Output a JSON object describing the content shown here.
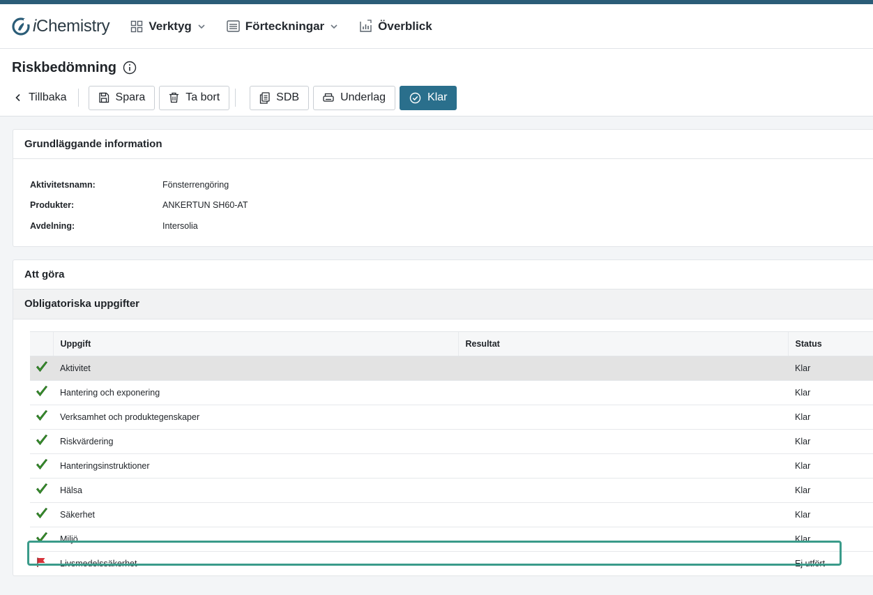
{
  "app": {
    "logo_prefix": "i",
    "logo_name": "Chemistry"
  },
  "nav": {
    "tools": "Verktyg",
    "lists": "Förteckningar",
    "overview": "Överblick"
  },
  "page": {
    "title": "Riskbedömning"
  },
  "toolbar": {
    "back": "Tillbaka",
    "save": "Spara",
    "delete": "Ta bort",
    "sds": "SDB",
    "basis": "Underlag",
    "done": "Klar"
  },
  "basic_info": {
    "header": "Grundläggande information",
    "rows": [
      {
        "label": "Aktivitetsnamn:",
        "value": "Fönsterrengöring"
      },
      {
        "label": "Produkter:",
        "value": "ANKERTUN SH60-AT"
      },
      {
        "label": "Avdelning:",
        "value": "Intersolia"
      }
    ]
  },
  "todo": {
    "header": "Att göra",
    "subheader": "Obligatoriska uppgifter",
    "columns": {
      "task": "Uppgift",
      "result": "Resultat",
      "status": "Status"
    },
    "rows": [
      {
        "task": "Aktivitet",
        "result": "",
        "status": "Klar",
        "icon": "check-icon"
      },
      {
        "task": "Hantering och exponering",
        "result": "",
        "status": "Klar",
        "icon": "check-icon"
      },
      {
        "task": "Verksamhet och produktegenskaper",
        "result": "",
        "status": "Klar",
        "icon": "check-icon"
      },
      {
        "task": "Riskvärdering",
        "result": "",
        "status": "Klar",
        "icon": "check-icon"
      },
      {
        "task": "Hanteringsinstruktioner",
        "result": "",
        "status": "Klar",
        "icon": "check-icon"
      },
      {
        "task": "Hälsa",
        "result": "",
        "status": "Klar",
        "icon": "check-icon"
      },
      {
        "task": "Säkerhet",
        "result": "",
        "status": "Klar",
        "icon": "check-icon"
      },
      {
        "task": "Miljö",
        "result": "",
        "status": "Klar",
        "icon": "check-icon"
      },
      {
        "task": "Livsmedelssäkerhet",
        "result": "",
        "status": "Ej utfört",
        "icon": "red-flag-icon"
      }
    ]
  },
  "colors": {
    "brand": "#2b5d78",
    "primary_button": "#2a6f8c",
    "focus_outline": "#3a9b8a",
    "check": "#3c9a2f",
    "flag": "#d8323a"
  }
}
